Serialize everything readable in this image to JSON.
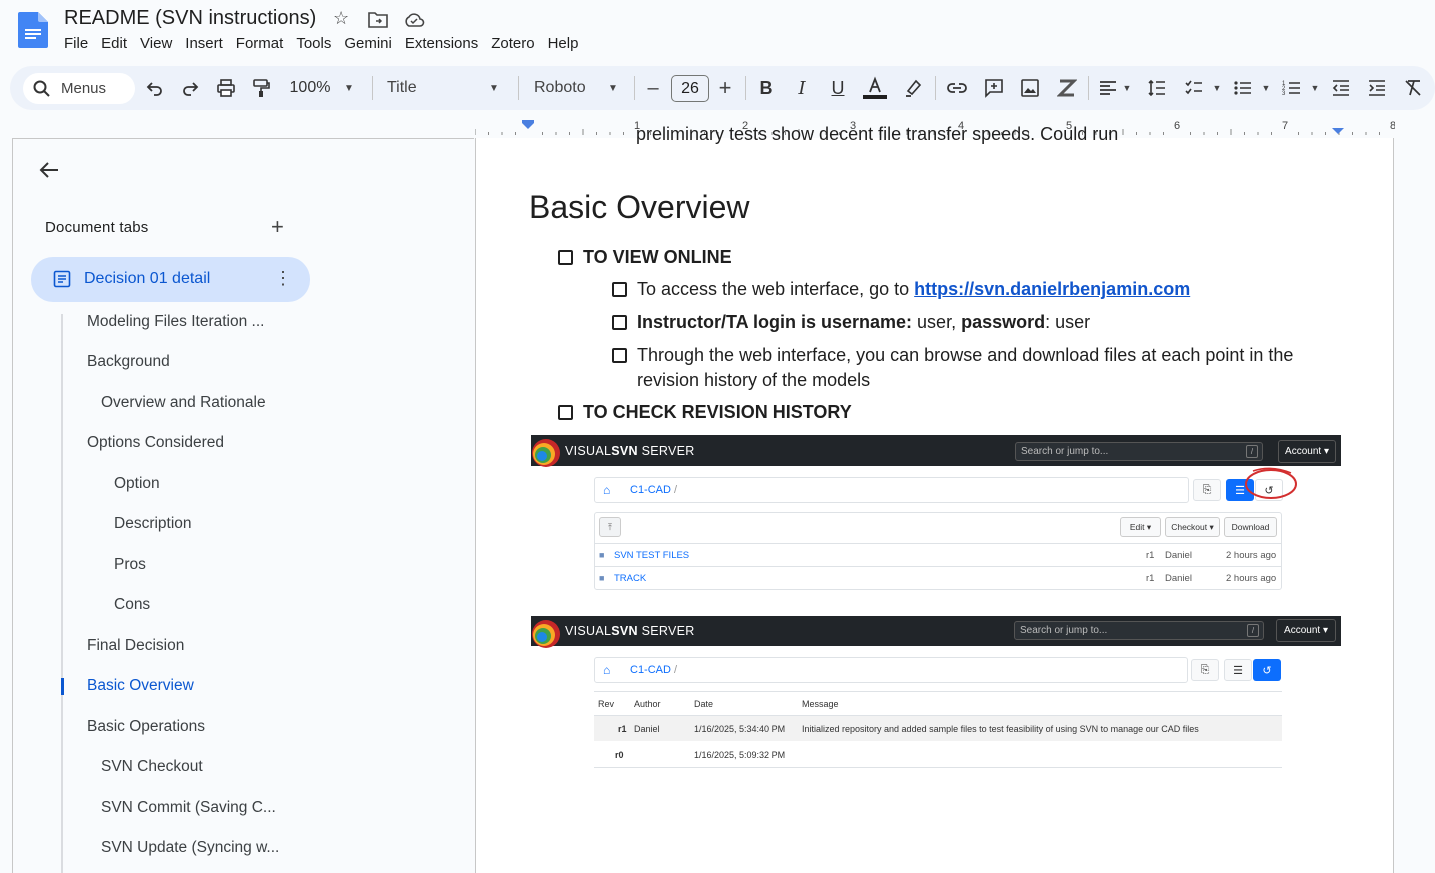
{
  "app": {
    "title": "README (SVN instructions)",
    "menu": [
      "File",
      "Edit",
      "View",
      "Insert",
      "Format",
      "Tools",
      "Gemini",
      "Extensions",
      "Zotero",
      "Help"
    ]
  },
  "toolbar": {
    "search_label": "Menus",
    "zoom": "100%",
    "style": "Title",
    "font": "Roboto",
    "font_size": "26",
    "minus": "–",
    "plus": "+"
  },
  "ruler": {
    "marks": [
      "1",
      "2",
      "3",
      "4",
      "5",
      "6",
      "7",
      "8"
    ]
  },
  "sidebar": {
    "heading": "Document tabs",
    "active_tab": "Decision 01 detail",
    "outline": [
      {
        "label": "Modeling Files Iteration ...",
        "level": 1
      },
      {
        "label": "Background",
        "level": 1
      },
      {
        "label": "Overview and Rationale",
        "level": 2
      },
      {
        "label": "Options Considered",
        "level": 1
      },
      {
        "label": "Option",
        "level": 3
      },
      {
        "label": "Description",
        "level": 3
      },
      {
        "label": "Pros",
        "level": 3
      },
      {
        "label": "Cons",
        "level": 3
      },
      {
        "label": "Final Decision",
        "level": 1
      },
      {
        "label": "Basic Overview",
        "level": 1,
        "active": true
      },
      {
        "label": "Basic Operations",
        "level": 1
      },
      {
        "label": "SVN Checkout",
        "level": 2
      },
      {
        "label": "SVN Commit (Saving C...",
        "level": 2
      },
      {
        "label": "SVN Update (Syncing w...",
        "level": 2
      }
    ]
  },
  "document": {
    "prev_text": "preliminary tests show decent file transfer speeds. Could run",
    "heading": "Basic Overview",
    "item_view_online": "TO VIEW ONLINE",
    "sub1_prefix": "To access the web interface, go to ",
    "sub1_link": "https://svn.danielrbenjamin.com",
    "sub2_b1": "Instructor/TA login is username:",
    "sub2_t1": " user, ",
    "sub2_b2": "password",
    "sub2_t2": ": user",
    "sub3_line1": "Through the web interface, you can browse and download files at each point in the",
    "sub3_line2": "revision history of the models",
    "item_revision": "TO CHECK REVISION HISTORY"
  },
  "svn1": {
    "brand_a": "VISUAL",
    "brand_b": "SVN",
    "brand_c": " SERVER",
    "search_placeholder": "Search or jump to...",
    "slash": "/",
    "account": "Account ▾",
    "repo": "C1-CAD",
    "crumb_sep": "/",
    "up": "⤒",
    "edit": "Edit ▾",
    "checkout": "Checkout ▾",
    "download": "Download",
    "rows": [
      {
        "name": "SVN TEST FILES",
        "rev": "r1",
        "author": "Daniel",
        "age": "2 hours ago"
      },
      {
        "name": "TRACK",
        "rev": "r1",
        "author": "Daniel",
        "age": "2 hours ago"
      }
    ]
  },
  "svn2": {
    "brand_a": "VISUAL",
    "brand_b": "SVN",
    "brand_c": " SERVER",
    "search_placeholder": "Search or jump to...",
    "slash": "/",
    "account": "Account ▾",
    "repo": "C1-CAD",
    "crumb_sep": "/",
    "headers": [
      "Rev",
      "Author",
      "Date",
      "Message"
    ],
    "rows": [
      {
        "rev": "r1",
        "author": "Daniel",
        "date": "1/16/2025, 5:34:40 PM",
        "message": "Initialized repository and added sample files to test feasibility of using SVN to manage our CAD files"
      },
      {
        "rev": "r0",
        "author": "",
        "date": "1/16/2025, 5:09:32 PM",
        "message": ""
      }
    ]
  },
  "colors": {
    "accent": "#0b57d0",
    "link": "#1155cc",
    "toolbar_bg": "#edf2fa",
    "active_tab_bg": "#d3e3fd",
    "svn_header": "#212529",
    "annotation_red": "#d32f2f"
  }
}
